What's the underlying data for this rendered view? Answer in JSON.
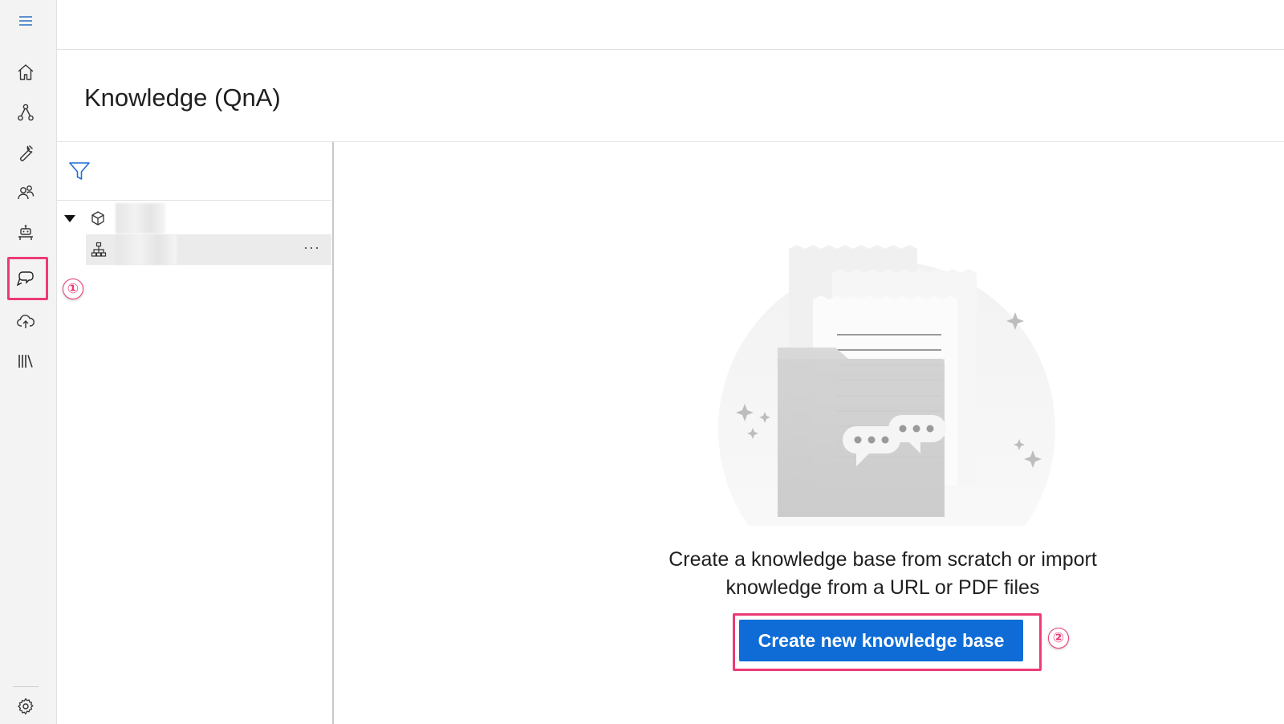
{
  "app": {
    "page_title": "Knowledge (QnA)"
  },
  "nav": {
    "items": [
      {
        "id": "home",
        "icon": "home-icon"
      },
      {
        "id": "flows",
        "icon": "flow-icon"
      },
      {
        "id": "tools",
        "icon": "wrench-icon"
      },
      {
        "id": "users",
        "icon": "people-icon"
      },
      {
        "id": "bot",
        "icon": "robot-icon"
      },
      {
        "id": "qna",
        "icon": "chat-bubbles-icon",
        "active": true
      },
      {
        "id": "publish",
        "icon": "cloud-upload-icon"
      },
      {
        "id": "library",
        "icon": "library-icon"
      }
    ],
    "settings_icon": "gear-icon"
  },
  "tree": {
    "filter_icon": "filter-icon",
    "nodes": [
      {
        "level": 0,
        "icon": "cube-icon",
        "expanded": true
      },
      {
        "level": 1,
        "icon": "hierarchy-icon",
        "selected": true,
        "more_label": "···"
      }
    ]
  },
  "empty_state": {
    "line1": "Create a knowledge base from scratch or import",
    "line2": "knowledge from a URL or PDF files",
    "button_label": "Create new knowledge base"
  },
  "annotations": {
    "step1": "①",
    "step2": "②",
    "color": "#ec3b75"
  },
  "colors": {
    "primary": "#0f6cd6",
    "rail_bg": "#f3f3f3",
    "highlight": "#ec3b75"
  }
}
